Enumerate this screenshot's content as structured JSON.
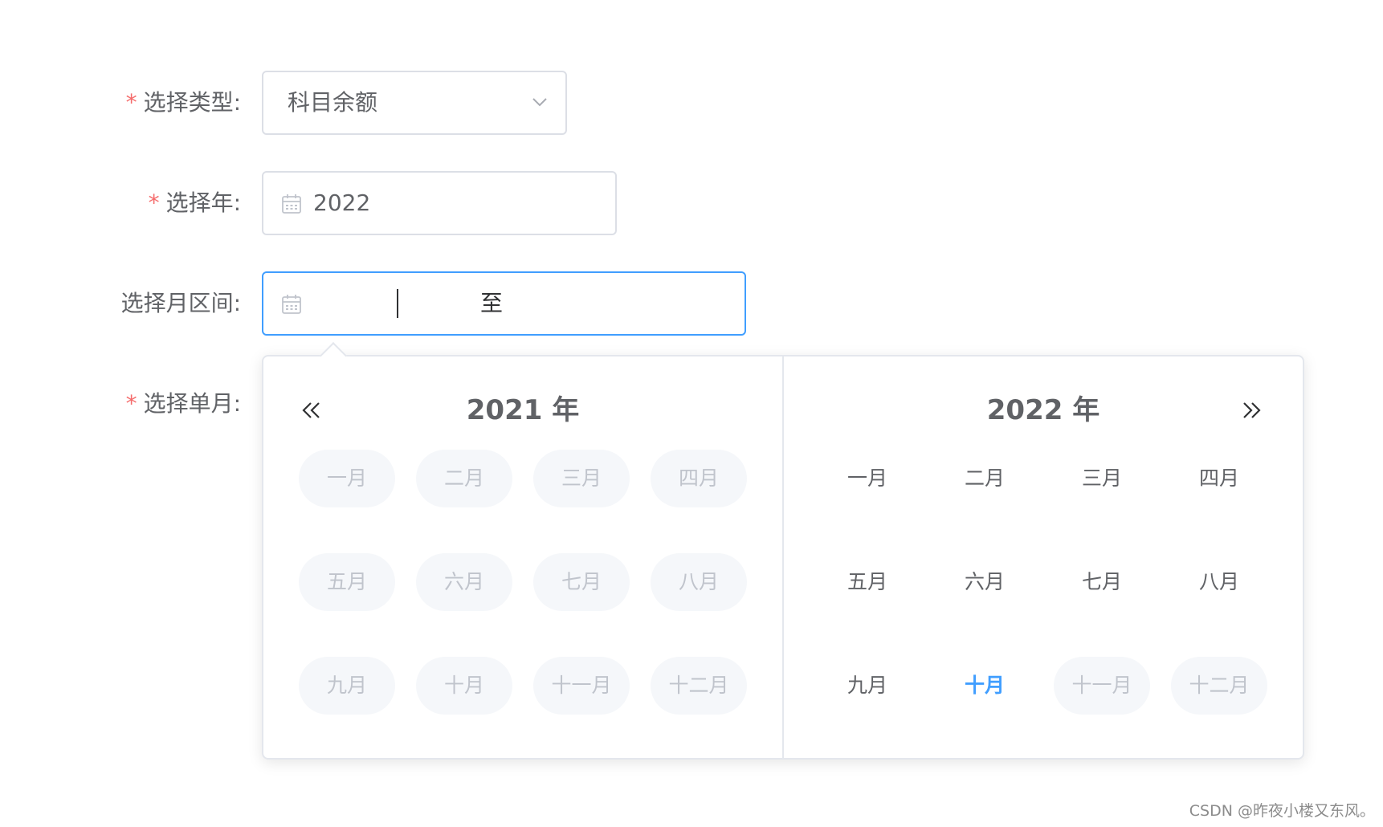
{
  "form": {
    "type": {
      "required_mark": "*",
      "label": "选择类型:",
      "value": "科目余额"
    },
    "year": {
      "required_mark": "*",
      "label": "选择年:",
      "value": "2022"
    },
    "month_range": {
      "label": "选择月区间:",
      "start": "",
      "separator": "至",
      "end": ""
    },
    "single_month": {
      "required_mark": "*",
      "label": "选择单月:"
    }
  },
  "picker": {
    "left": {
      "title": "2021 年",
      "months": [
        {
          "label": "一月",
          "state": "disabled"
        },
        {
          "label": "二月",
          "state": "disabled"
        },
        {
          "label": "三月",
          "state": "disabled"
        },
        {
          "label": "四月",
          "state": "disabled"
        },
        {
          "label": "五月",
          "state": "disabled"
        },
        {
          "label": "六月",
          "state": "disabled"
        },
        {
          "label": "七月",
          "state": "disabled"
        },
        {
          "label": "八月",
          "state": "disabled"
        },
        {
          "label": "九月",
          "state": "disabled"
        },
        {
          "label": "十月",
          "state": "disabled"
        },
        {
          "label": "十一月",
          "state": "disabled"
        },
        {
          "label": "十二月",
          "state": "disabled"
        }
      ]
    },
    "right": {
      "title": "2022 年",
      "months": [
        {
          "label": "一月",
          "state": "normal"
        },
        {
          "label": "二月",
          "state": "normal"
        },
        {
          "label": "三月",
          "state": "normal"
        },
        {
          "label": "四月",
          "state": "normal"
        },
        {
          "label": "五月",
          "state": "normal"
        },
        {
          "label": "六月",
          "state": "normal"
        },
        {
          "label": "七月",
          "state": "normal"
        },
        {
          "label": "八月",
          "state": "normal"
        },
        {
          "label": "九月",
          "state": "normal"
        },
        {
          "label": "十月",
          "state": "current"
        },
        {
          "label": "十一月",
          "state": "disabled"
        },
        {
          "label": "十二月",
          "state": "disabled"
        }
      ]
    },
    "icons": {
      "prev_year": "double-chevron-left-icon",
      "next_year": "double-chevron-right-icon"
    }
  },
  "colors": {
    "accent": "#409eff",
    "required": "#f56c6c",
    "disabled_bg": "#f5f7fa",
    "disabled_text": "#c0c4cc"
  },
  "watermark": "CSDN @昨夜小楼又东风。"
}
